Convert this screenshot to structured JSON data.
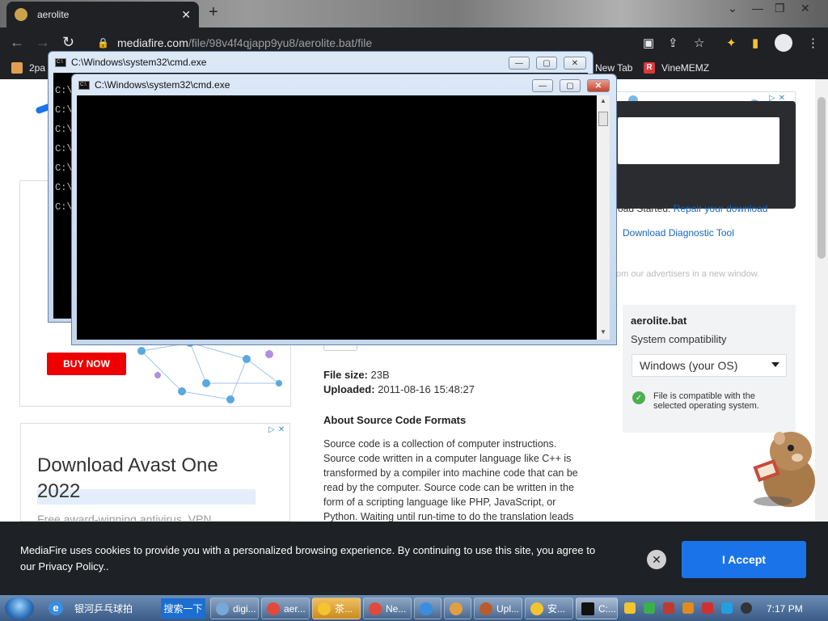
{
  "browser": {
    "tab_title": "aerolite",
    "url_domain": "mediafire.com",
    "url_path": "/file/98v4f4qjapp9yu8/aerolite.bat/file",
    "bookmarks": [
      {
        "label": "2pa",
        "color": "#e0a050"
      },
      {
        "label": "New Tab",
        "color": "#e8eaed"
      },
      {
        "label": "VineMEMZ",
        "color": "#d83a3a"
      }
    ]
  },
  "cmd_back": {
    "title": "C:\\Windows\\system32\\cmd.exe",
    "lines": [
      "C:\\",
      "C:\\",
      "C:\\",
      "C:\\",
      "C:\\",
      "C:\\",
      "C:\\"
    ]
  },
  "cmd_front": {
    "title": "C:\\Windows\\system32\\cmd.exe"
  },
  "ads": {
    "buy_now": "BUY NOW",
    "avast_heading": "Download Avast One 2022",
    "avast_sub": "Free award-winning antivirus, VPN"
  },
  "download_panel": {
    "started_text": "oad Started.",
    "repair_link": "Repair your download",
    "diagnostic_link": "Download Diagnostic Tool",
    "advertisers_note": "om our advertisers in a new window."
  },
  "file_info": {
    "name": "aerolite.bat",
    "system_compat_label": "System compatibility",
    "os_selected": "Windows (your OS)",
    "compat_message": "File is compatible with the selected operating system."
  },
  "file_meta": {
    "size_label": "File size:",
    "size_value": "23B",
    "uploaded_label": "Uploaded:",
    "uploaded_value": "2011-08-16 15:48:27",
    "about_title": "About Source Code Formats",
    "about_body": "Source code is a collection of computer instructions. Source code written in a computer language like C++ is transformed by a compiler into machine code that can be read by the computer. Source code can be written in the form of a scripting language like PHP, JavaScript, or Python. Waiting until run-time to do the translation leads"
  },
  "cookie": {
    "text": "MediaFire uses cookies to provide you with a personalized browsing experience. By continuing to use this site, you agree to our Privacy Policy..",
    "accept": "I Accept"
  },
  "taskbar": {
    "ie_input": "银河乒乓球拍",
    "search_button": "搜索一下",
    "items": [
      {
        "label": "digi...",
        "color": "#7aa7d8"
      },
      {
        "label": "aer...",
        "color": "#e04a3a"
      },
      {
        "label": "茶...",
        "color": "#f4c430"
      },
      {
        "label": "Ne...",
        "color": "#e04a3a"
      },
      {
        "label": "",
        "color": "#3a8ee0"
      },
      {
        "label": "",
        "color": "#e0a040"
      },
      {
        "label": "Upl...",
        "color": "#b85c2e"
      },
      {
        "label": "安...",
        "color": "#f4c430"
      },
      {
        "label": "C:...",
        "color": "#111111"
      }
    ],
    "clock": "7:17 PM"
  }
}
